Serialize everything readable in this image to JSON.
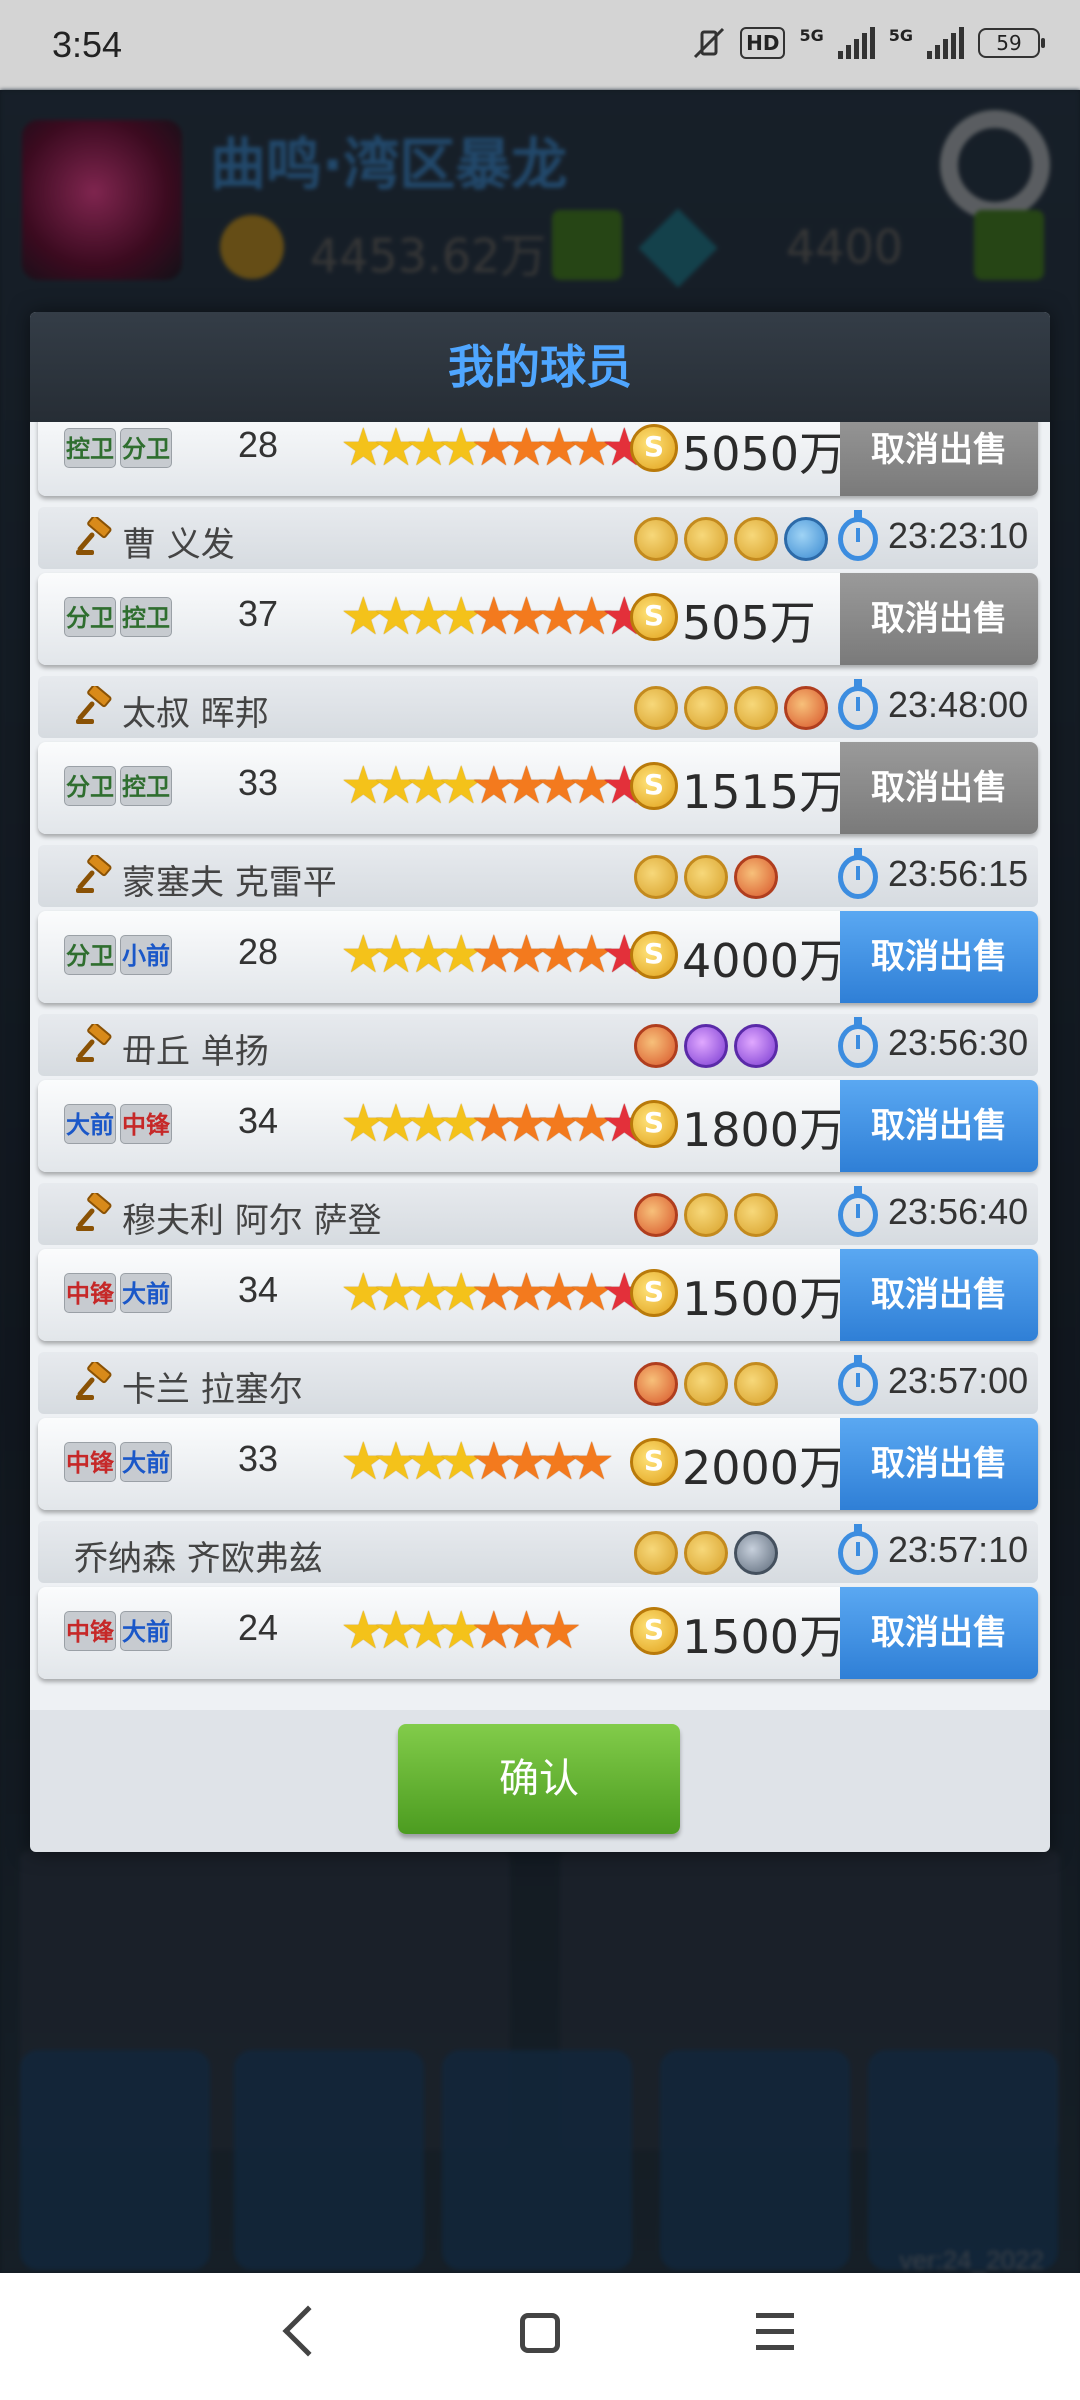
{
  "status_bar": {
    "time": "3:54",
    "hd_label": "HD",
    "network_1": "5G",
    "network_2": "5G",
    "battery": "59"
  },
  "background": {
    "team_name": "曲鸣·湾区暴龙",
    "money": "4453.62万",
    "gems": "4400",
    "version": "ver:24_2022"
  },
  "modal": {
    "title": "我的球员",
    "cancel_label": "取消出售",
    "confirm_label": "确认",
    "players": [
      {
        "name": "",
        "gavel": false,
        "badges": [],
        "time": "",
        "positions": [
          {
            "label": "控卫",
            "cls": "df"
          },
          {
            "label": "分卫",
            "cls": "df"
          }
        ],
        "age": "28",
        "stars": [
          "y",
          "y",
          "y",
          "y",
          "o",
          "o",
          "o",
          "o",
          "r"
        ],
        "price": "5050万",
        "button_state": "gray"
      },
      {
        "name": "曹 义发",
        "gavel": true,
        "badges": [
          "gold",
          "gold",
          "gold",
          "blue"
        ],
        "time": "23:23:10",
        "positions": [
          {
            "label": "分卫",
            "cls": "df"
          },
          {
            "label": "控卫",
            "cls": "df"
          }
        ],
        "age": "37",
        "stars": [
          "y",
          "y",
          "y",
          "y",
          "o",
          "o",
          "o",
          "o",
          "r"
        ],
        "price": "505万",
        "button_state": "gray"
      },
      {
        "name": "太叔 晖邦",
        "gavel": true,
        "badges": [
          "gold",
          "gold",
          "gold",
          "red"
        ],
        "time": "23:48:00",
        "positions": [
          {
            "label": "分卫",
            "cls": "df"
          },
          {
            "label": "控卫",
            "cls": "df"
          }
        ],
        "age": "33",
        "stars": [
          "y",
          "y",
          "y",
          "y",
          "o",
          "o",
          "o",
          "o",
          "r",
          "r"
        ],
        "price": "1515万",
        "button_state": "gray"
      },
      {
        "name": "蒙塞夫 克雷平",
        "gavel": true,
        "badges": [
          "gold",
          "gold",
          "red"
        ],
        "time": "23:56:15",
        "positions": [
          {
            "label": "分卫",
            "cls": "df"
          },
          {
            "label": "小前",
            "cls": "mf"
          }
        ],
        "age": "28",
        "stars": [
          "y",
          "y",
          "y",
          "y",
          "o",
          "o",
          "o",
          "o",
          "r"
        ],
        "price": "4000万",
        "button_state": "blue"
      },
      {
        "name": "毌丘 单扬",
        "gavel": true,
        "badges": [
          "red",
          "purple",
          "purple"
        ],
        "time": "23:56:30",
        "positions": [
          {
            "label": "大前",
            "cls": "mf"
          },
          {
            "label": "中锋",
            "cls": "fw"
          }
        ],
        "age": "34",
        "stars": [
          "y",
          "y",
          "y",
          "y",
          "o",
          "o",
          "o",
          "o",
          "r"
        ],
        "price": "1800万",
        "button_state": "blue"
      },
      {
        "name": "穆夫利 阿尔 萨登",
        "gavel": true,
        "badges": [
          "red",
          "gold",
          "gold"
        ],
        "time": "23:56:40",
        "positions": [
          {
            "label": "中锋",
            "cls": "fw"
          },
          {
            "label": "大前",
            "cls": "mf"
          }
        ],
        "age": "34",
        "stars": [
          "y",
          "y",
          "y",
          "y",
          "o",
          "o",
          "o",
          "o",
          "r"
        ],
        "price": "1500万",
        "button_state": "blue"
      },
      {
        "name": "卡兰 拉塞尔",
        "gavel": true,
        "badges": [
          "red",
          "gold",
          "gold"
        ],
        "time": "23:57:00",
        "positions": [
          {
            "label": "中锋",
            "cls": "fw"
          },
          {
            "label": "大前",
            "cls": "mf"
          }
        ],
        "age": "33",
        "stars": [
          "y",
          "y",
          "y",
          "y",
          "o",
          "o",
          "o",
          "o"
        ],
        "price": "2000万",
        "button_state": "blue"
      },
      {
        "name": "乔纳森 齐欧弗兹",
        "gavel": false,
        "badges": [
          "gold",
          "gold",
          "gray"
        ],
        "time": "23:57:10",
        "positions": [
          {
            "label": "中锋",
            "cls": "fw"
          },
          {
            "label": "大前",
            "cls": "mf"
          }
        ],
        "age": "24",
        "stars": [
          "y",
          "y",
          "y",
          "y",
          "o",
          "o",
          "o"
        ],
        "price": "1500万",
        "button_state": "blue"
      }
    ]
  }
}
